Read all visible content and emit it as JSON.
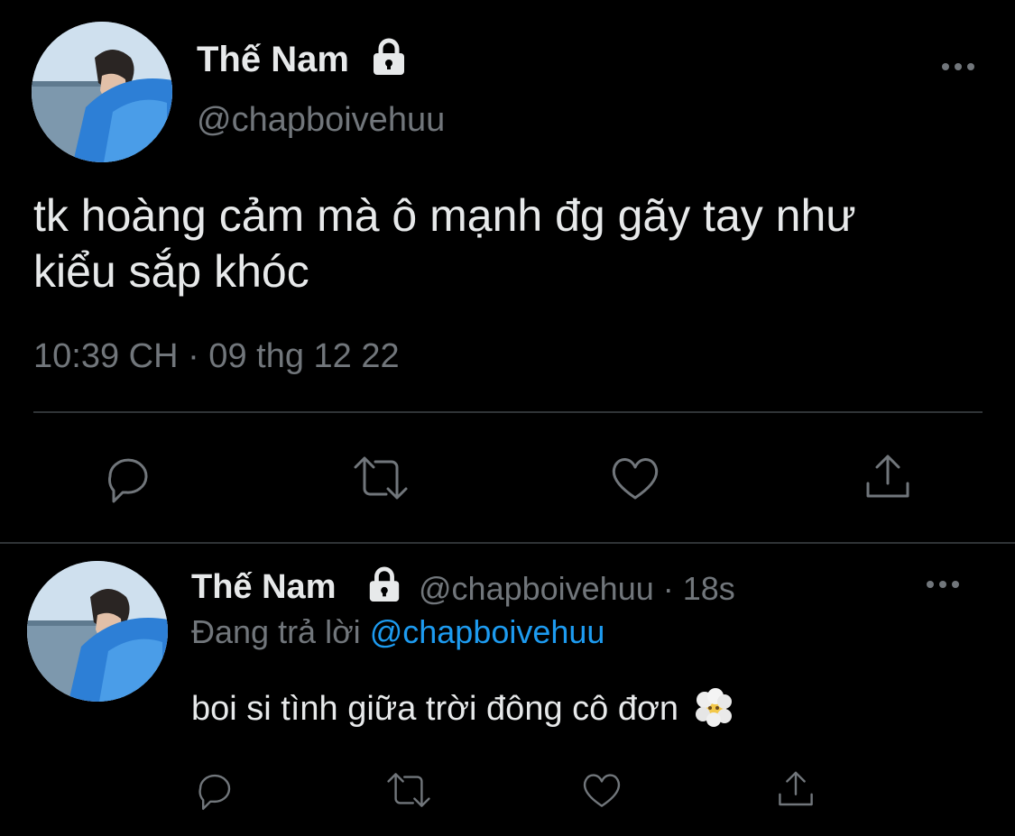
{
  "main_tweet": {
    "display_name": "Thế Nam",
    "handle": "@chapboivehuu",
    "text_line1": "tk hoàng cảm mà ô mạnh đg gãy tay như",
    "text_line2": "kiểu sắp khóc",
    "timestamp": "10:39 CH · 09 thg 12 22",
    "icons": {
      "lock": "lock-icon",
      "more": "more-icon",
      "reply": "reply-icon",
      "retweet": "retweet-icon",
      "like": "heart-icon",
      "share": "share-icon"
    }
  },
  "reply_tweet": {
    "display_name": "Thế Nam",
    "handle_time": "@chapboivehuu · 18s",
    "replying_prefix": "Đang trả lời",
    "replying_to": "@chapboivehuu",
    "text": "boi si tình giữa trời đông cô đơn",
    "emoji": "face-in-clouds-emoji"
  },
  "colors": {
    "background": "#000000",
    "text": "#e7e9ea",
    "muted": "#71767b",
    "link": "#1d9bf0",
    "divider": "#2f3336"
  }
}
